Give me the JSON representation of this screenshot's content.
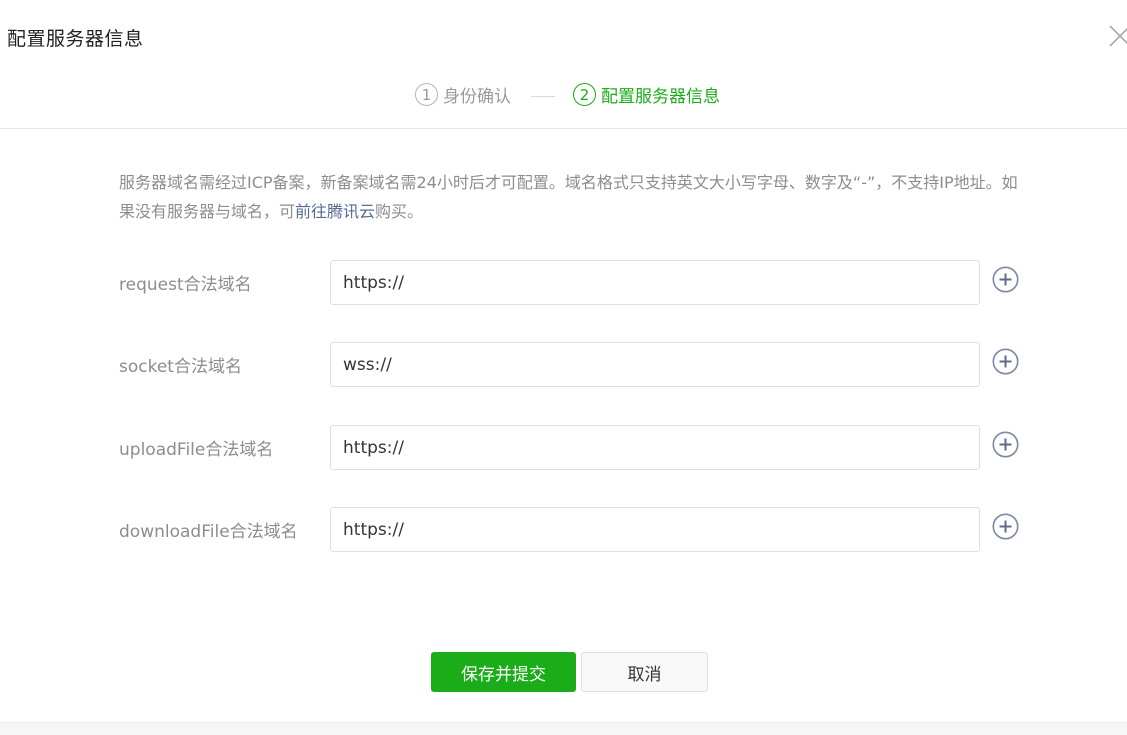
{
  "dialog": {
    "title": "配置服务器信息",
    "close_icon": "close-icon"
  },
  "steps": [
    {
      "number": "1",
      "label": "身份确认",
      "state": "done"
    },
    {
      "number": "2",
      "label": "配置服务器信息",
      "state": "active"
    }
  ],
  "notice": {
    "text_before_link": "服务器域名需经过ICP备案，新备案域名需24小时后才可配置。域名格式只支持英文大小写字母、数字及“-”，不支持IP地址。如果没有服务器与域名，可",
    "link_text": "前往腾讯云",
    "text_after_link": "购买。"
  },
  "form": {
    "rows": [
      {
        "label": "request合法域名",
        "value": "https://"
      },
      {
        "label": "socket合法域名",
        "value": "wss://"
      },
      {
        "label": "uploadFile合法域名",
        "value": "https://"
      },
      {
        "label": "downloadFile合法域名",
        "value": "https://"
      }
    ],
    "add_icon": "plus-circle-icon"
  },
  "actions": {
    "submit_label": "保存并提交",
    "cancel_label": "取消"
  },
  "colors": {
    "accent": "#1aad19",
    "link": "#576b95",
    "muted_text": "#8d8d8d",
    "icon": "#7d88a3"
  }
}
